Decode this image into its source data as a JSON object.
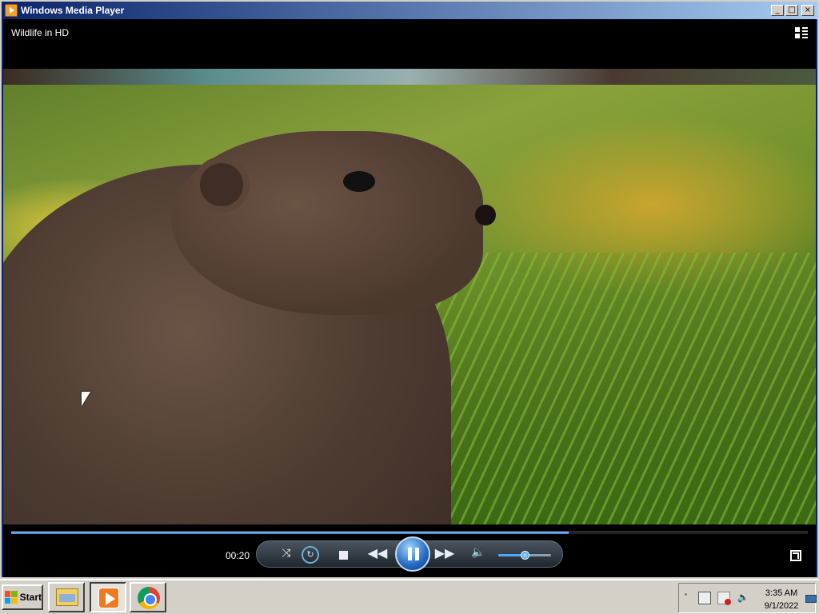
{
  "window": {
    "title": "Windows Media Player",
    "minimize_glyph": "_",
    "maximize_glyph": "□",
    "close_glyph": "×"
  },
  "player": {
    "media_title": "Wildlife in HD",
    "current_time": "00:20",
    "seek_progress_percent": 70,
    "volume_percent": 50,
    "state": "playing"
  },
  "controls": {
    "shuffle_glyph": "⤨",
    "repeat_glyph": "↻",
    "prev_glyph": "◀◀",
    "next_glyph": "▶▶",
    "volume_glyph": "🔈"
  },
  "taskbar": {
    "start_label": "Start",
    "tray_expand_glyph": "˄",
    "speaker_glyph": "🔈",
    "clock_time": "3:35 AM",
    "clock_date": "9/1/2022",
    "start_logo_colors": [
      "#f25022",
      "#7fba00",
      "#00a4ef",
      "#ffb900"
    ]
  }
}
